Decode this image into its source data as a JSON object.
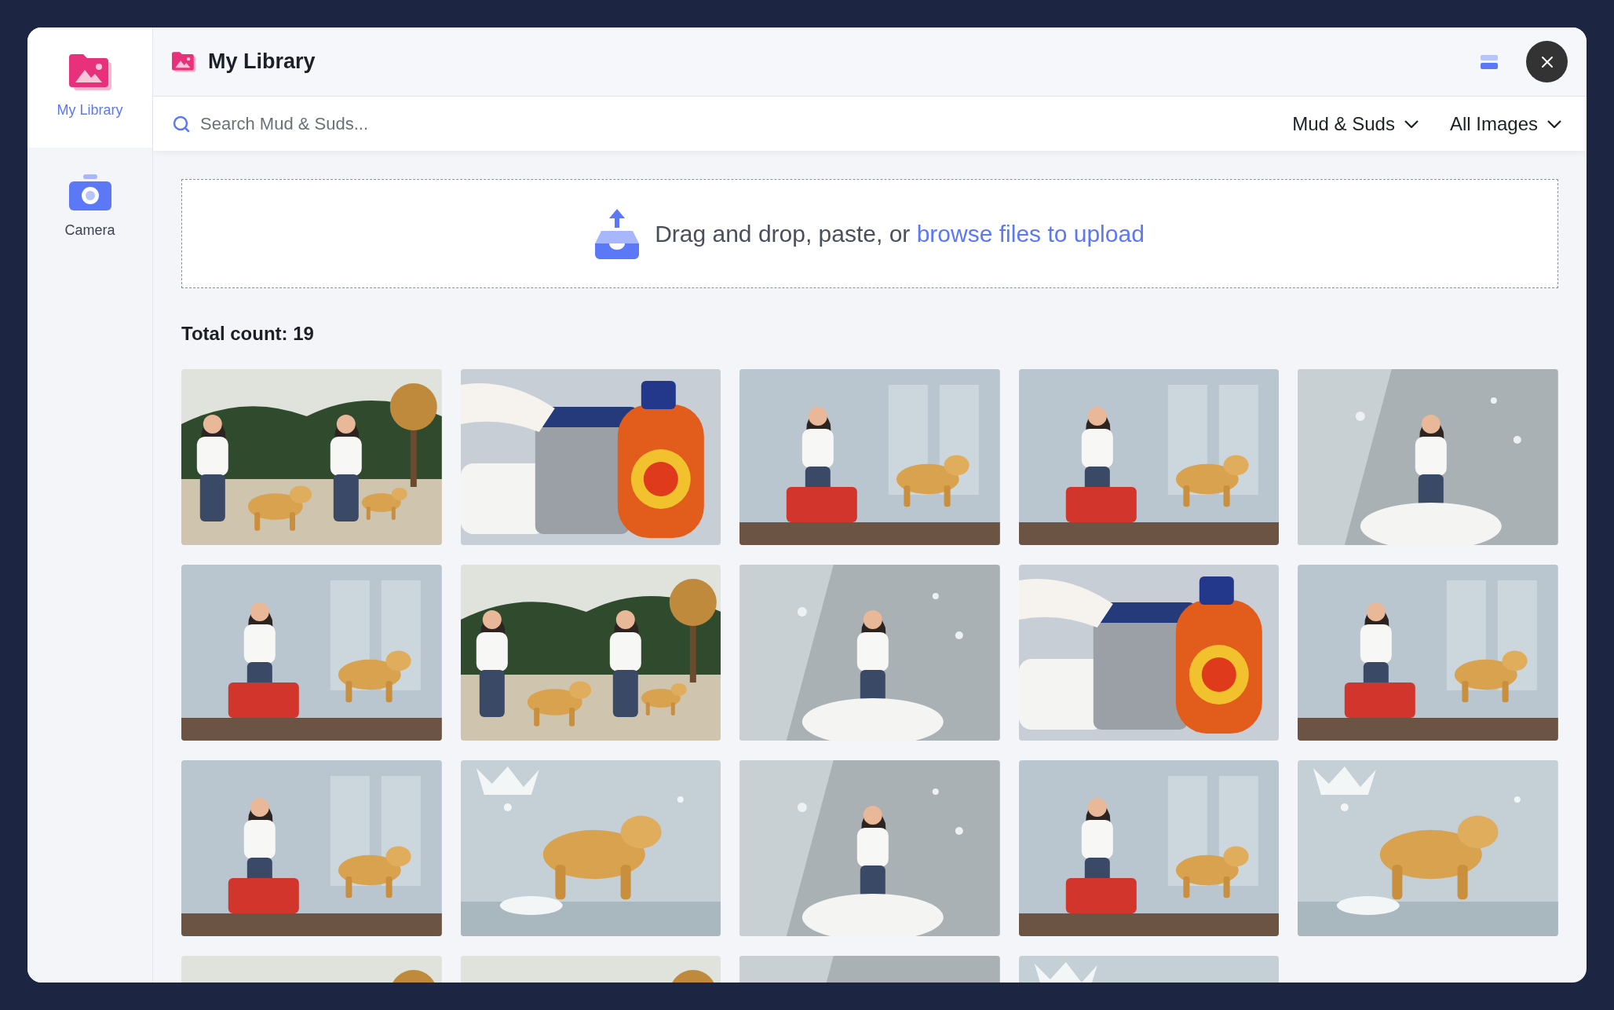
{
  "sidebar": {
    "items": [
      {
        "label": "My Library",
        "kind": "library",
        "selected": true
      },
      {
        "label": "Camera",
        "kind": "camera",
        "selected": false
      }
    ]
  },
  "header": {
    "title": "My Library"
  },
  "search": {
    "placeholder": "Search Mud & Suds..."
  },
  "filters": [
    {
      "label": "Mud & Suds"
    },
    {
      "label": "All Images"
    }
  ],
  "upload": {
    "text": "Drag and drop, paste, or ",
    "link": "browse files to upload"
  },
  "gallery": {
    "count_label": "Total count: 19"
  }
}
